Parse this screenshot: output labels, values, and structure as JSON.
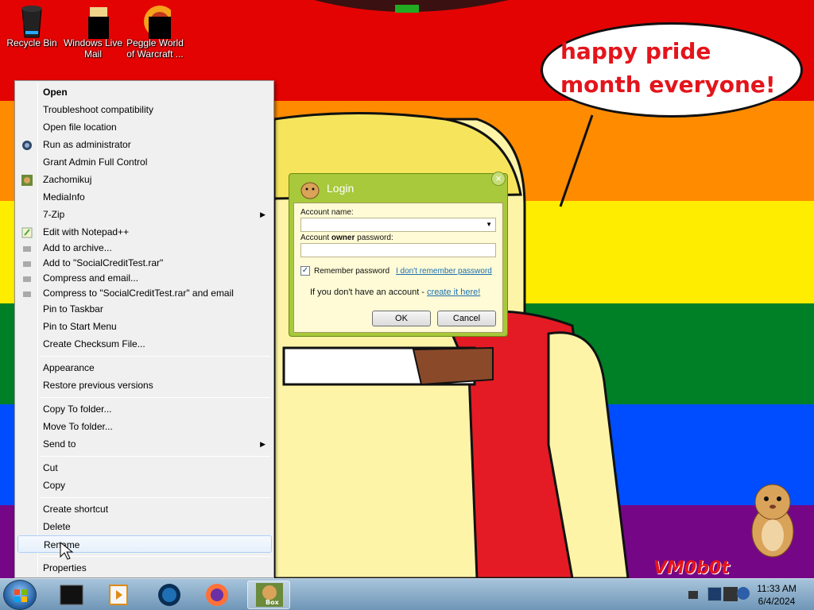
{
  "desktop": {
    "icons": [
      {
        "label": "Recycle Bin"
      },
      {
        "label": "Windows Live Mail"
      },
      {
        "label": "Peggle World of Warcraft ..."
      }
    ],
    "bubble_text": "happy pride month everyone!",
    "watermark": "VM0b0t"
  },
  "context_menu": {
    "items": [
      {
        "label": "Open"
      },
      {
        "label": "Troubleshoot compatibility"
      },
      {
        "label": "Open file location"
      },
      {
        "label": "Run as administrator"
      },
      {
        "label": "Grant Admin Full Control"
      },
      {
        "label": "Zachomikuj"
      },
      {
        "label": "MediaInfo"
      },
      {
        "label": "7-Zip"
      },
      {
        "label": "Edit with Notepad++"
      },
      {
        "label": "Add to archive..."
      },
      {
        "label": "Add to \"SocialCreditTest.rar\""
      },
      {
        "label": "Compress and email..."
      },
      {
        "label": "Compress to \"SocialCreditTest.rar\" and email"
      },
      {
        "label": "Pin to Taskbar"
      },
      {
        "label": "Pin to Start Menu"
      },
      {
        "label": "Create Checksum File..."
      },
      {
        "label": "Appearance"
      },
      {
        "label": "Restore previous versions"
      },
      {
        "label": "Copy To folder..."
      },
      {
        "label": "Move To folder..."
      },
      {
        "label": "Send to"
      },
      {
        "label": "Cut"
      },
      {
        "label": "Copy"
      },
      {
        "label": "Create shortcut"
      },
      {
        "label": "Delete"
      },
      {
        "label": "Rename"
      },
      {
        "label": "Properties"
      }
    ]
  },
  "login_dialog": {
    "title": "Login",
    "close_glyph": "×",
    "account_name_label": "Account name:",
    "password_label_pre": "Account ",
    "password_label_bold": "owner",
    "password_label_post": " password:",
    "remember_label": "Remember password",
    "remember_checked": true,
    "forgot_link": "I don't remember password",
    "no_account_text": "If you don't have an account - ",
    "create_link": "create it here!",
    "ok_label": "OK",
    "cancel_label": "Cancel"
  },
  "taskbar": {
    "active_item_caption": "Box",
    "time": "11:33 AM",
    "date": "6/4/2024"
  }
}
